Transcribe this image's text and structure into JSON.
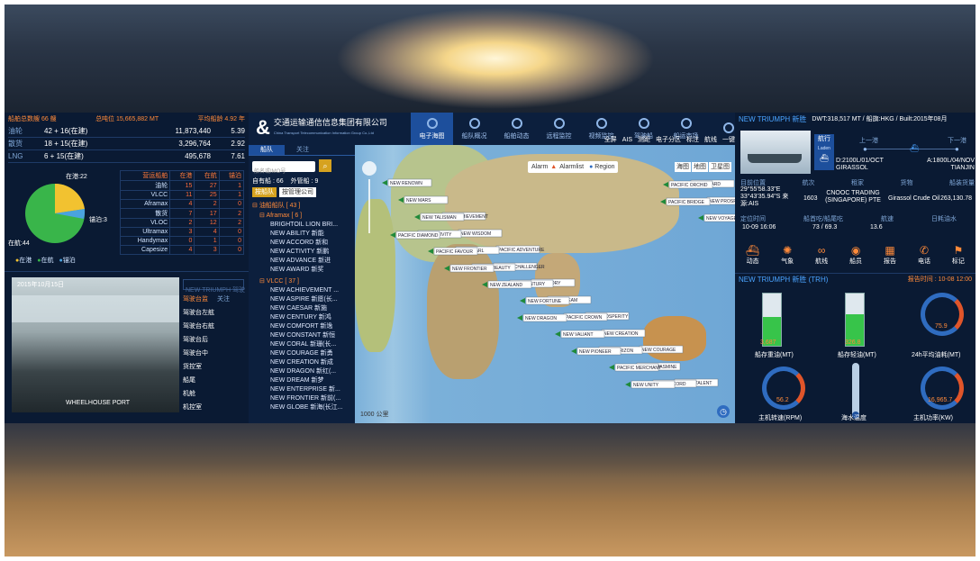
{
  "header": {
    "fleet_total": "船舶总数艘 66 艘",
    "total_dwt": "总吨位 15,665,882 MT",
    "avg_age": "平均船龄 4.92 年"
  },
  "fleet_rows": [
    {
      "type": "油轮",
      "count": "42 + 16(在建)",
      "dwt": "11,873,440",
      "age": "5.39"
    },
    {
      "type": "散货",
      "count": "18 + 15(在建)",
      "dwt": "3,296,764",
      "age": "2.92"
    },
    {
      "type": "LNG",
      "count": "6 + 15(在建)",
      "dwt": "495,678",
      "age": "7.61"
    }
  ],
  "pie": {
    "label_port": "在港:22",
    "label_sail": "在航:44",
    "label_anchor": "锚泊:3",
    "legend": [
      "在港",
      "在航",
      "锚泊"
    ],
    "colors": {
      "port": "#f2c230",
      "sail": "#39b54a",
      "anchor": "#4aa3df"
    }
  },
  "ship_table": {
    "headers": [
      "营运船舶",
      "在港",
      "在航",
      "锚泊"
    ],
    "rows": [
      [
        "油轮",
        "15",
        "27",
        "1"
      ],
      [
        "VLCC",
        "11",
        "25",
        "1"
      ],
      [
        "Aframax",
        "4",
        "2",
        "0"
      ],
      [
        "散货",
        "7",
        "17",
        "2"
      ],
      [
        "VLOC",
        "2",
        "12",
        "2"
      ],
      [
        "Ultramax",
        "3",
        "4",
        "0"
      ],
      [
        "Handymax",
        "0",
        "1",
        "0"
      ],
      [
        "Capesize",
        "4",
        "3",
        "0"
      ]
    ]
  },
  "camera": {
    "timestamp": "2015年10月15日",
    "search_placeholder": "NEW TRIUMPH 驾驶",
    "tabs": [
      "驾驶台监",
      "关注"
    ],
    "caption": "WHEELHOUSE PORT",
    "list": [
      "驾驶台左舷",
      "驾驶台右舷",
      "驾驶台后",
      "驾驶台中",
      "货控室",
      "船尾",
      "机舱",
      "机控室"
    ]
  },
  "company": {
    "name": "交通运输通信信息集团有限公司",
    "sub": "China Transport Telecommunication Information Group Co.,Ltd"
  },
  "nav_tabs": [
    {
      "label": "电子海图",
      "active": true
    },
    {
      "label": "船队概况"
    },
    {
      "label": "船舶动态"
    },
    {
      "label": "远程监控"
    },
    {
      "label": "视频监控"
    },
    {
      "label": "驾驶船"
    },
    {
      "label": "船运市场"
    },
    {
      "label": ""
    }
  ],
  "sidebar": {
    "tabs": [
      "船队",
      "关注"
    ],
    "search_placeholder": "船名或IMO号",
    "self_count": "自有船 : 66",
    "managed_count": "外管船 : 9",
    "btn_fleet": "按船队",
    "btn_company": "按管理公司",
    "group_main": "油船船队 [ 43 ]",
    "group_aframax": "Aframax [ 6 ]",
    "aframax_ships": [
      "BRIGHTOIL LION BRI...",
      "NEW ABILITY 新能",
      "NEW ACCORD 新和",
      "NEW ACTIVITY 新鹏",
      "NEW ADVANCE 新进",
      "NEW AWARD 新奖"
    ],
    "group_vlcc": "VLCC [ 37 ]",
    "vlcc_ships": [
      "NEW ACHIEVEMENT ...",
      "NEW ASPIRE 新愿(长...",
      "NEW CAESAR 新施",
      "NEW CENTURY 新鸿",
      "NEW COMFORT 新逸",
      "NEW CONSTANT 新恒",
      "NEW CORAL 新珊(长...",
      "NEW COURAGE 新勇",
      "NEW CREATION 新成",
      "NEW DRAGON 新红(...",
      "NEW DREAM 新梦",
      "NEW ENTERPRISE 新...",
      "NEW FRONTIER 新前(...",
      "NEW GLOBE 新海(长江..."
    ]
  },
  "map": {
    "toolbar": [
      "全屏",
      "AIS",
      "测距",
      "电子分区",
      "标注",
      "航线",
      "一键"
    ],
    "alarm": "Alarm",
    "alarm_list": "Alarmlist",
    "region": "Region",
    "layers": [
      "海图",
      "地图",
      "卫星图"
    ],
    "ship_labels": [
      "NEW RENOWN",
      "NEW ACHIEVEMENT",
      "PACIFIC ADVENTURE",
      "NEW GLORY",
      "NEW PROSPERITY",
      "NEW COURAGE",
      "PACIFIC TALENT",
      "NEW MARS",
      "NEW WISDOM",
      "PACIFIC CHALLENGER",
      "NEW DREAM",
      "NEW CREATION",
      "PACIFIC JASMINE",
      "NEW AWARD",
      "NEW TALISMAN",
      "NEW PEARL",
      "NEW CENTURY",
      "PACIFIC CROWN",
      "NEW HORIZON",
      "NEW ACCORD",
      "NEW PROSPECT",
      "NEW ACTIVITY",
      "PACIFIC BEAUTY",
      "NEW FORTUNE",
      "NEW VALIANT",
      "PACIFIC MERCHANT",
      "PACIFIC ORCHID",
      "NEW VOYAGE",
      "PACIFIC FAVOUR",
      "NEW ZEALAND",
      "NEW DRAGON",
      "NEW PIONEER",
      "NEW UNITY",
      "PACIFIC BRIDGE",
      "PACIFIC DIAMOND",
      "NEW FRONTIER"
    ],
    "scale": "1000 公里"
  },
  "right": {
    "ship_title": "NEW TRIUMPH 新胜",
    "ship_meta": "DWT:318,517 MT / 船旗:HKG / Built:2015年08月",
    "status_badge": "航行",
    "status_sub": "Laden",
    "prev_port_label": "上一港",
    "next_port_label": "下一港",
    "prev_port": "D:2100L/01/OCT GIRASSOL",
    "next_port": "A:1800L/04/NOV TIANJIN",
    "info_headers": [
      "目前位置",
      "航次",
      "租家",
      "货物",
      "船装货量"
    ],
    "position": "29°55'58.33\"E 33°43'35.94\"S 来源:AIS",
    "voyage": "1603",
    "charterer": "CNOOC TRADING (SINGAPORE) PTE",
    "cargo": "Girassol Crude Oil",
    "quantity": "263,130.78",
    "time_headers": [
      "定位时间",
      "船首吃/船尾吃",
      "航速",
      "日耗油水"
    ],
    "pos_time": "10-09 16:06",
    "draft": "73 / 69.3",
    "speed": "13.6",
    "actions": [
      "动态",
      "气象",
      "航线",
      "船员",
      "报告",
      "电话",
      "标记"
    ],
    "monitor_title": "NEW TRIUMPH 新胜 (TRH)",
    "report_time": "报告时间 : 10-08 12:00",
    "tank1_label": "船存重油(MT)",
    "tank1_value": "3,687",
    "tank1_level": 0.55,
    "tank2_label": "船存轻油(MT)",
    "tank2_value": "326.8",
    "tank2_level": 0.6,
    "gauge1_label": "24h平均油耗(MT)",
    "gauge1_value": "75.9",
    "gauge2_label": "主机转速(RPM)",
    "gauge2_value": "56.2",
    "thermo_label": "海水温度",
    "gauge3_label": "主机功率(KW)",
    "gauge3_value": "16,965.7"
  }
}
